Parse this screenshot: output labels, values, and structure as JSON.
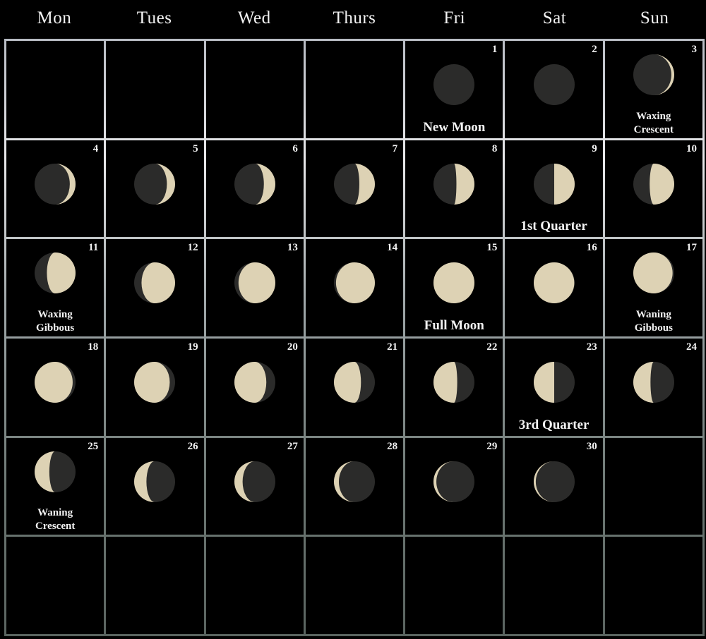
{
  "weekdays": [
    "Mon",
    "Tues",
    "Wed",
    "Thurs",
    "Fri",
    "Sat",
    "Sun"
  ],
  "first_weekday_index": 4,
  "colors": {
    "dark_moon": "#2b2b2a",
    "lit_moon": "#ddd2b4",
    "background": "#000000",
    "text": "#f2f2f2"
  },
  "days": [
    {
      "day": "1",
      "illumination": 0,
      "phase": "waxing",
      "label": "New Moon"
    },
    {
      "day": "2",
      "illumination": 0.01,
      "phase": "waxing"
    },
    {
      "day": "3",
      "illumination": 0.07,
      "phase": "waxing",
      "label": "Waxing Crescent"
    },
    {
      "day": "4",
      "illumination": 0.14,
      "phase": "waxing"
    },
    {
      "day": "5",
      "illumination": 0.2,
      "phase": "waxing"
    },
    {
      "day": "6",
      "illumination": 0.28,
      "phase": "waxing"
    },
    {
      "day": "7",
      "illumination": 0.38,
      "phase": "waxing"
    },
    {
      "day": "8",
      "illumination": 0.44,
      "phase": "waxing"
    },
    {
      "day": "9",
      "illumination": 0.5,
      "phase": "waxing",
      "label": "1st Quarter"
    },
    {
      "day": "10",
      "illumination": 0.6,
      "phase": "waxing"
    },
    {
      "day": "11",
      "illumination": 0.7,
      "phase": "waxing",
      "label": "Waxing Gibbous"
    },
    {
      "day": "12",
      "illumination": 0.82,
      "phase": "waxing"
    },
    {
      "day": "13",
      "illumination": 0.9,
      "phase": "waxing"
    },
    {
      "day": "14",
      "illumination": 0.95,
      "phase": "waxing"
    },
    {
      "day": "15",
      "illumination": 1,
      "phase": "waxing",
      "label": "Full Moon"
    },
    {
      "day": "16",
      "illumination": 0.99,
      "phase": "waning"
    },
    {
      "day": "17",
      "illumination": 0.96,
      "phase": "waning",
      "label": "Waning Gibbous"
    },
    {
      "day": "18",
      "illumination": 0.93,
      "phase": "waning"
    },
    {
      "day": "19",
      "illumination": 0.87,
      "phase": "waning"
    },
    {
      "day": "20",
      "illumination": 0.78,
      "phase": "waning"
    },
    {
      "day": "21",
      "illumination": 0.66,
      "phase": "waning"
    },
    {
      "day": "22",
      "illumination": 0.58,
      "phase": "waning"
    },
    {
      "day": "23",
      "illumination": 0.5,
      "phase": "waning",
      "label": "3rd Quarter"
    },
    {
      "day": "24",
      "illumination": 0.42,
      "phase": "waning"
    },
    {
      "day": "25",
      "illumination": 0.36,
      "phase": "waning",
      "label": "Waning Crescent"
    },
    {
      "day": "26",
      "illumination": 0.3,
      "phase": "waning"
    },
    {
      "day": "27",
      "illumination": 0.2,
      "phase": "waning"
    },
    {
      "day": "28",
      "illumination": 0.12,
      "phase": "waning"
    },
    {
      "day": "29",
      "illumination": 0.07,
      "phase": "waning"
    },
    {
      "day": "30",
      "illumination": 0.05,
      "phase": "waning"
    }
  ]
}
